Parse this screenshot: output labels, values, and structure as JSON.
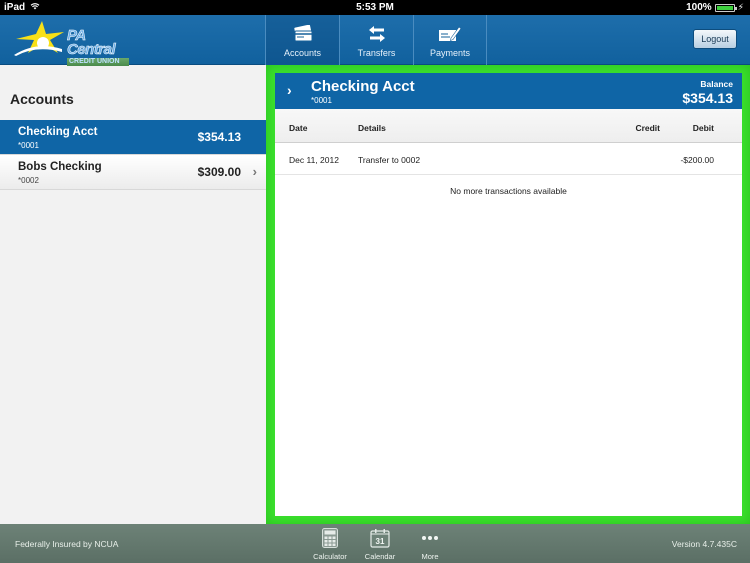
{
  "status_bar": {
    "device": "iPad",
    "time": "5:53 PM",
    "battery": "100%",
    "battery_level": 1.0
  },
  "header": {
    "logo": {
      "line1": "PA Central",
      "line2": "CREDIT UNION"
    },
    "nav_tabs": [
      {
        "label": "Accounts",
        "icon": "accounts-card-icon",
        "active": true
      },
      {
        "label": "Transfers",
        "icon": "transfer-arrows-icon",
        "active": false
      },
      {
        "label": "Payments",
        "icon": "check-pen-icon",
        "active": false
      }
    ],
    "logout_label": "Logout"
  },
  "sidebar": {
    "title": "Accounts",
    "accounts": [
      {
        "name": "Checking Acct",
        "number": "*0001",
        "balance": "$354.13",
        "selected": true
      },
      {
        "name": "Bobs Checking",
        "number": "*0002",
        "balance": "$309.00",
        "selected": false
      }
    ]
  },
  "detail": {
    "account_name": "Checking Acct",
    "account_number": "*0001",
    "balance_label": "Balance",
    "balance": "$354.13",
    "columns": {
      "date": "Date",
      "details": "Details",
      "credit": "Credit",
      "debit": "Debit"
    },
    "transactions": [
      {
        "date": "Dec 11, 2012",
        "details": "Transfer to 0002",
        "credit": "",
        "debit": "-$200.00"
      }
    ],
    "empty_message": "No more transactions available"
  },
  "footer": {
    "left_text": "Federally Insured by NCUA",
    "tools": [
      {
        "label": "Calculator",
        "icon": "calculator-icon"
      },
      {
        "label": "Calendar",
        "icon": "calendar-icon",
        "day": "31"
      },
      {
        "label": "More",
        "icon": "more-dots-icon"
      }
    ],
    "version": "Version 4.7.435C"
  },
  "colors": {
    "brand_blue": "#0f65a6",
    "highlight_green": "#3be02e",
    "footer_gray_green": "#62776c"
  }
}
